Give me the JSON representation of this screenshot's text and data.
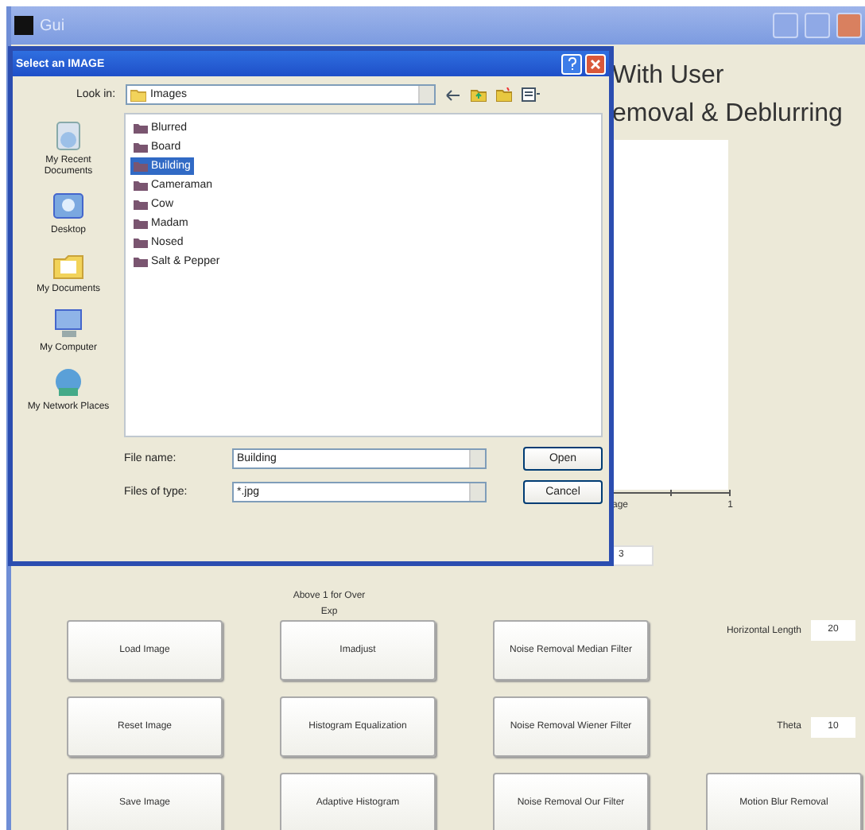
{
  "window": {
    "title": "Gui"
  },
  "main": {
    "heading_lines": [
      "With User",
      "emoval & Deblurring"
    ],
    "axes": {
      "x_label": "age",
      "x_tick": "1"
    },
    "field_value": "3",
    "note_lines": [
      "Above 1 for Over",
      "Exp"
    ],
    "button_rows": [
      [
        "Load Image",
        "Imadjust",
        "Noise Removal Median Filter"
      ],
      [
        "Reset Image",
        "Histogram Equalization",
        "Noise Removal Wiener Filter"
      ],
      [
        "Save Image",
        "Adaptive Histogram",
        "Noise Removal Our Filter"
      ]
    ],
    "parameters": [
      {
        "label": "Horizontal Length",
        "value": "20"
      },
      {
        "label": "Theta",
        "value": "10"
      }
    ],
    "motion_button": "Motion Blur Removal"
  },
  "dialog": {
    "title": "Select an IMAGE",
    "look_in_label": "Look in:",
    "look_in": "Images",
    "places": [
      {
        "kind": "recent",
        "label": "My Recent Documents"
      },
      {
        "kind": "desktop",
        "label": "Desktop"
      },
      {
        "kind": "documents",
        "label": "My Documents"
      },
      {
        "kind": "computer",
        "label": "My Computer"
      },
      {
        "kind": "network",
        "label": "My Network Places"
      }
    ],
    "files": [
      {
        "name": "Blurred",
        "selected": false
      },
      {
        "name": "Board",
        "selected": false
      },
      {
        "name": "Building",
        "selected": true
      },
      {
        "name": "Cameraman",
        "selected": false
      },
      {
        "name": "Cow",
        "selected": false
      },
      {
        "name": "Madam",
        "selected": false
      },
      {
        "name": "Nosed",
        "selected": false
      },
      {
        "name": "Salt & Pepper",
        "selected": false
      }
    ],
    "file_name_label": "File name:",
    "file_name": "Building",
    "file_type_label": "Files of type:",
    "file_type": "*.jpg",
    "buttons": [
      "Open",
      "Cancel"
    ]
  }
}
